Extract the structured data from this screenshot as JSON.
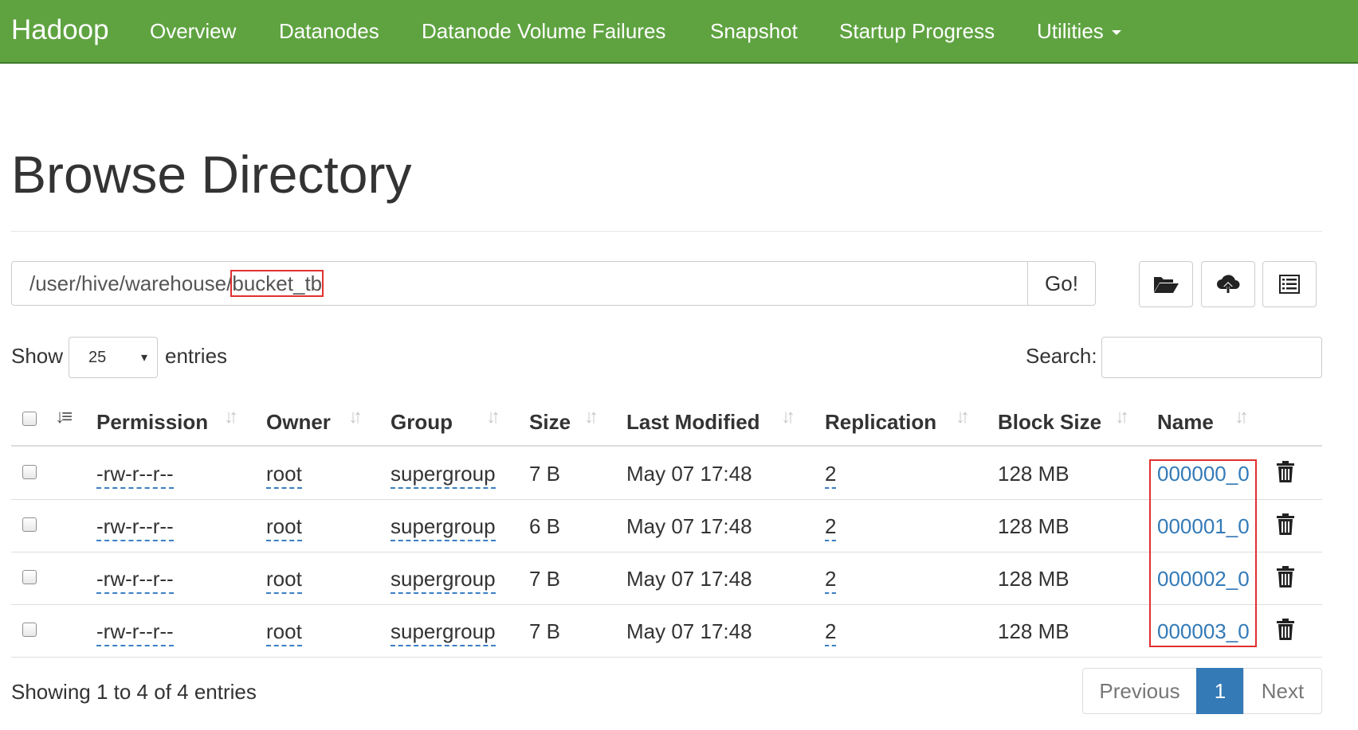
{
  "navbar": {
    "brand": "Hadoop",
    "items": [
      "Overview",
      "Datanodes",
      "Datanode Volume Failures",
      "Snapshot",
      "Startup Progress",
      "Utilities"
    ]
  },
  "page": {
    "title": "Browse Directory"
  },
  "path": {
    "prefix": "/user/hive/warehouse/",
    "highlighted": "bucket_tb",
    "go_label": "Go!"
  },
  "toolbar": {
    "icons": [
      "folder-open-icon",
      "cloud-upload-icon",
      "list-icon"
    ]
  },
  "length_menu": {
    "show_label": "Show",
    "selected": "25",
    "entries_label": "entries"
  },
  "search": {
    "label": "Search:",
    "value": ""
  },
  "table": {
    "headers": [
      "Permission",
      "Owner",
      "Group",
      "Size",
      "Last Modified",
      "Replication",
      "Block Size",
      "Name"
    ],
    "rows": [
      {
        "permission": "-rw-r--r--",
        "owner": "root",
        "group": "supergroup",
        "size": "7 B",
        "modified": "May 07 17:48",
        "replication": "2",
        "block_size": "128 MB",
        "name": "000000_0"
      },
      {
        "permission": "-rw-r--r--",
        "owner": "root",
        "group": "supergroup",
        "size": "6 B",
        "modified": "May 07 17:48",
        "replication": "2",
        "block_size": "128 MB",
        "name": "000001_0"
      },
      {
        "permission": "-rw-r--r--",
        "owner": "root",
        "group": "supergroup",
        "size": "7 B",
        "modified": "May 07 17:48",
        "replication": "2",
        "block_size": "128 MB",
        "name": "000002_0"
      },
      {
        "permission": "-rw-r--r--",
        "owner": "root",
        "group": "supergroup",
        "size": "7 B",
        "modified": "May 07 17:48",
        "replication": "2",
        "block_size": "128 MB",
        "name": "000003_0"
      }
    ]
  },
  "footer": {
    "info": "Showing 1 to 4 of 4 entries",
    "previous": "Previous",
    "current_page": "1",
    "next": "Next"
  },
  "colors": {
    "navbar": "#5fa341",
    "link": "#337ab7",
    "active_page": "#337ab7",
    "highlight": "#e03030"
  }
}
